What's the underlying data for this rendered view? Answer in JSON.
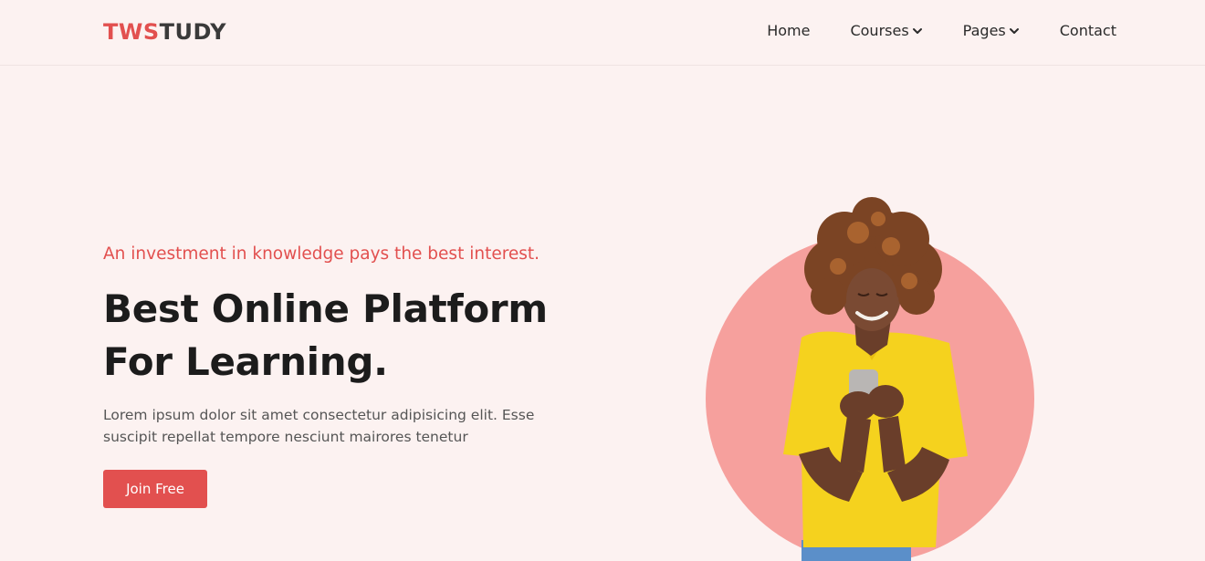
{
  "brand": {
    "part1": "TWS",
    "part2": "TUDY"
  },
  "nav": {
    "items": [
      {
        "label": "Home",
        "dropdown": false
      },
      {
        "label": "Courses",
        "dropdown": true
      },
      {
        "label": "Pages",
        "dropdown": true
      },
      {
        "label": "Contact",
        "dropdown": false
      }
    ]
  },
  "hero": {
    "tagline": "An investment in knowledge pays the best interest.",
    "title_line1": "Best Online Platform",
    "title_line2": "For Learning.",
    "description": "Lorem ipsum dolor sit amet consectetur adipisicing elit. Esse suscipit repellat tempore nesciunt mairores tenetur",
    "cta_label": "Join Free"
  },
  "colors": {
    "accent": "#e2504f",
    "background": "#fcf2f1",
    "circle": "#f6a09d",
    "shirt": "#f5d21e"
  },
  "icons": [
    "chevron-down-icon"
  ]
}
